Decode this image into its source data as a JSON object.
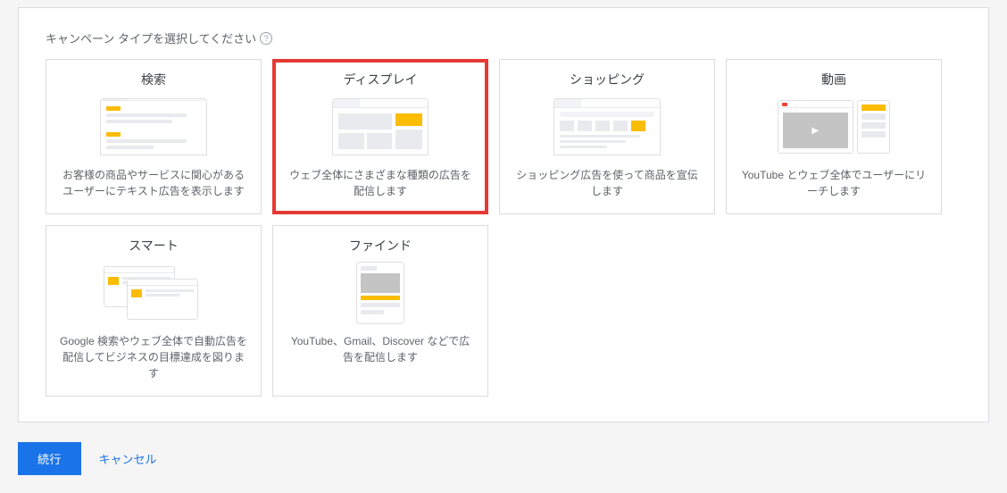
{
  "section_title": "キャンペーン タイプを選択してください",
  "help_symbol": "?",
  "cards": [
    {
      "title": "検索",
      "desc": "お客様の商品やサービスに関心があるユーザーにテキスト広告を表示します"
    },
    {
      "title": "ディスプレイ",
      "desc": "ウェブ全体にさまざまな種類の広告を配信します"
    },
    {
      "title": "ショッピング",
      "desc": "ショッピング広告を使って商品を宣伝します"
    },
    {
      "title": "動画",
      "desc": "YouTube とウェブ全体でユーザーにリーチします"
    },
    {
      "title": "スマート",
      "desc": "Google 検索やウェブ全体で自動広告を配信してビジネスの目標達成を図ります"
    },
    {
      "title": "ファインド",
      "desc": "YouTube、Gmail、Discover などで広告を配信します"
    }
  ],
  "actions": {
    "continue": "続行",
    "cancel": "キャンセル"
  }
}
